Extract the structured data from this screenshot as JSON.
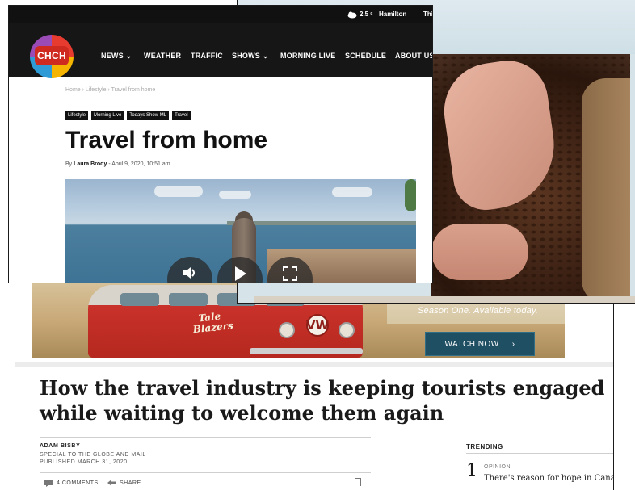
{
  "chch": {
    "topbar": {
      "weather_temp": "2.5 ᶜ",
      "weather_city": "Hamilton",
      "weather_day": "Thi"
    },
    "logo_text": "CHCH",
    "nav": [
      "NEWS ⌄",
      "WEATHER",
      "TRAFFIC",
      "SHOWS ⌄",
      "MORNING LIVE",
      "SCHEDULE",
      "ABOUT US"
    ],
    "breadcrumb": "Home  ›  Lifestyle  ›  Travel from home",
    "tags": [
      "Lifestyle",
      "Morning Live",
      "Todays Show ML",
      "Travel"
    ],
    "title": "Travel from home",
    "meta_by": "By",
    "meta_author": "Laura Brody",
    "meta_date": " - April 9, 2020, 10:51 am",
    "video_controls": [
      "volume-icon",
      "play-icon",
      "fullscreen-icon"
    ]
  },
  "globe": {
    "banner": {
      "van_badge": "Tale Blazers",
      "van_logo": "VW",
      "tagline": "Season One. Available today.",
      "watch_label": "WATCH NOW",
      "watch_chevron": "›"
    },
    "headline": "How the travel industry is keeping tourists engaged while waiting to welcome them again",
    "byline_name": "ADAM BISBY",
    "byline_special": "SPECIAL TO THE GLOBE AND MAIL",
    "byline_published": "PUBLISHED MARCH 31, 2020",
    "comments": "4 COMMENTS",
    "share": "SHARE",
    "trending_label": "TRENDING",
    "trending_num": "1",
    "trending_cat": "OPINION",
    "trending_text": "There's reason for hope in Canada'"
  },
  "colors": {
    "chch_nav_bg": "#161616",
    "chch_logo_red": "#cf2a1f",
    "globe_watch_btn": "#1f4f63",
    "van_red": "#c9322a"
  }
}
